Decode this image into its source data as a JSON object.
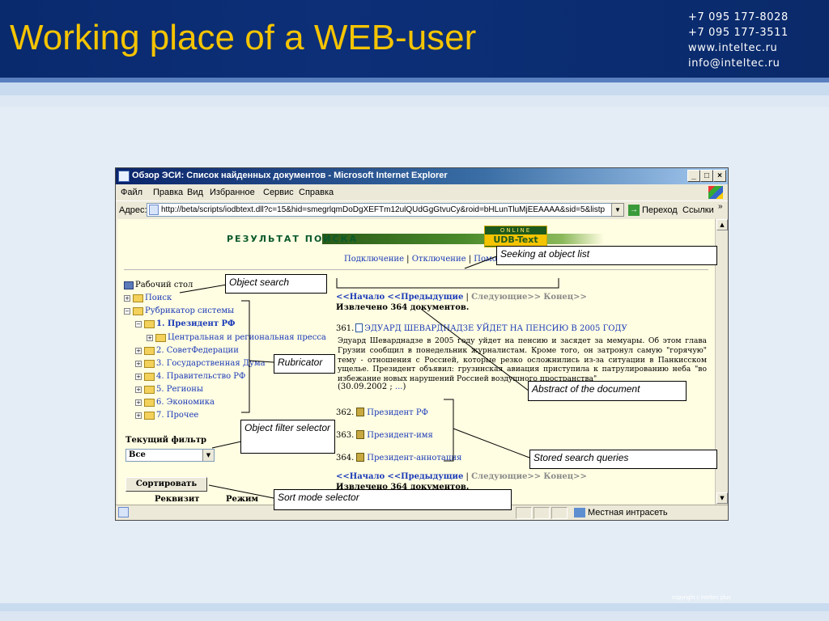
{
  "slide": {
    "title": "Working place of a WEB-user",
    "contacts": [
      "+7 095 177-8028",
      "+7 095 177-3511",
      "www.inteltec.ru",
      "info@inteltec.ru"
    ],
    "copyright": "copyright c inteltec plus"
  },
  "window": {
    "title": "Обзор ЭСИ: Список найденных документов - Microsoft Internet Explorer",
    "menu": [
      "Файл",
      "Правка",
      "Вид",
      "Избранное",
      "Сервис",
      "Справка"
    ],
    "address_label": "Адрес:",
    "address_url": "http://beta/scripts/iodbtext.dll?c=15&hid=smegrlqmDoDgXEFTm12ulQUdGgGtvuCy&roid=bHLunTluMjEEAAAA&sid=5&listp",
    "go_label": "Переход",
    "links_label": "Ссылки",
    "links_more": "»",
    "status_zone": "Местная интрасеть"
  },
  "page": {
    "banner_text": "РЕЗУЛЬТАТ ПОИСКА",
    "banner_logo_top": "ONLINE",
    "banner_logo_main": "UDB-Text",
    "top_links": [
      "Подключение",
      "Отключение",
      "Помощь"
    ],
    "tree": {
      "root": "Рабочий стол",
      "items": [
        {
          "label": "Поиск"
        },
        {
          "label": "Рубрикатор системы"
        },
        {
          "label": "1. Президент РФ"
        },
        {
          "label": "Центральная и региональная пресса"
        },
        {
          "label": "2. СоветФедерации"
        },
        {
          "label": "3. Государственная Дума"
        },
        {
          "label": "4. Правительство РФ"
        },
        {
          "label": "5. Регионы"
        },
        {
          "label": "6. Экономика"
        },
        {
          "label": "7. Прочее"
        }
      ]
    },
    "filter_label": "Текущий фильтр",
    "filter_value": "Все",
    "sort_button": "Сортировать",
    "col_requisite": "Реквизит",
    "col_mode": "Режим",
    "nav": {
      "start": "<<Начало",
      "prev": "<<Предыдущие",
      "sep": "|",
      "next": "Следующие>>",
      "end": "Конец>>"
    },
    "found": "Извлечено 364 документов.",
    "doc": {
      "num": "361.",
      "title": "ЭДУАРД ШЕВАРДНАДЗЕ УЙДЕТ НА ПЕНСИЮ В 2005 ГОДУ",
      "abstract": "Эдуард Шеварднадзе в 2005 году уйдет на пенсию и засядет за мемуары. Об этом глава Грузии сообщил в понедельник журналистам. Кроме того, он затронул самую \"горячую\" тему - отношения с Россией, которые резко осложнились из-за ситуации в Панкисском ущелье. Президент объявил: грузинская авиация приступила к патрулированию неба \"во избежание новых нарушений Россией воздушного пространства\"",
      "date_open": "(30.09.2002 ;",
      "date_link": "...",
      "date_close": ")"
    },
    "queries": [
      {
        "num": "362.",
        "label": "Президент РФ"
      },
      {
        "num": "363.",
        "label": "Президент-имя"
      },
      {
        "num": "364.",
        "label": "Президент-аннотация"
      }
    ]
  },
  "callouts": {
    "seeking": "Seeking at object list",
    "object_search": "Object search",
    "rubricator": "Rubricator",
    "abstract": "Abstract of the document",
    "filter": "Object filter selector",
    "stored": "Stored search queries",
    "sort": "Sort mode selector"
  }
}
